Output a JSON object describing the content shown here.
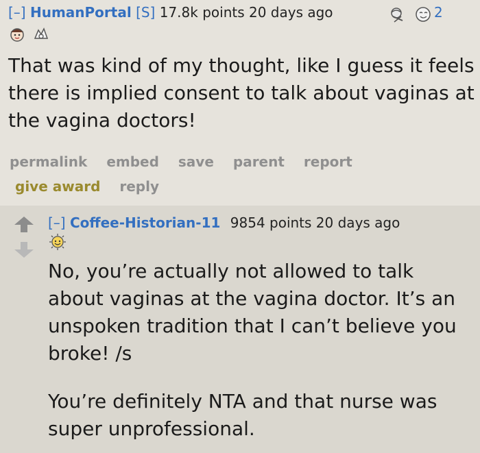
{
  "parent_comment": {
    "collapse": "[–]",
    "author": "HumanPortal",
    "submitter_tag": "[S]",
    "score_time": "17.8k points 20 days ago",
    "award_count": "2",
    "body": "That was kind of my thought, like I guess it feels there is implied consent to talk about vaginas at the vagina doctors!",
    "buttons": {
      "permalink": "permalink",
      "embed": "embed",
      "save": "save",
      "parent": "parent",
      "report": "report",
      "give_award": "give award",
      "reply": "reply"
    }
  },
  "reply_comment": {
    "collapse": "[–]",
    "author": "Coffee-Historian-11",
    "score_time": "9854 points 20 days ago",
    "paragraphs": [
      "No, you’re actually not allowed to talk about vaginas at the vagina doctor. It’s an unspoken tradition that I can’t believe you broke! /s",
      "You’re definitely NTA and that nurse was super unprofessional."
    ]
  },
  "colors": {
    "link_blue": "#336fc0",
    "award_gold": "#9a8a2e",
    "button_gray": "#8f8f8f",
    "background": "#dad7cf"
  },
  "icons": [
    "award-ice-icon",
    "award-hands-icon",
    "award-face-icon",
    "award-crying-face-icon",
    "award-helpful-icon",
    "upvote-arrow-icon",
    "downvote-arrow-icon",
    "award-sun-icon"
  ]
}
